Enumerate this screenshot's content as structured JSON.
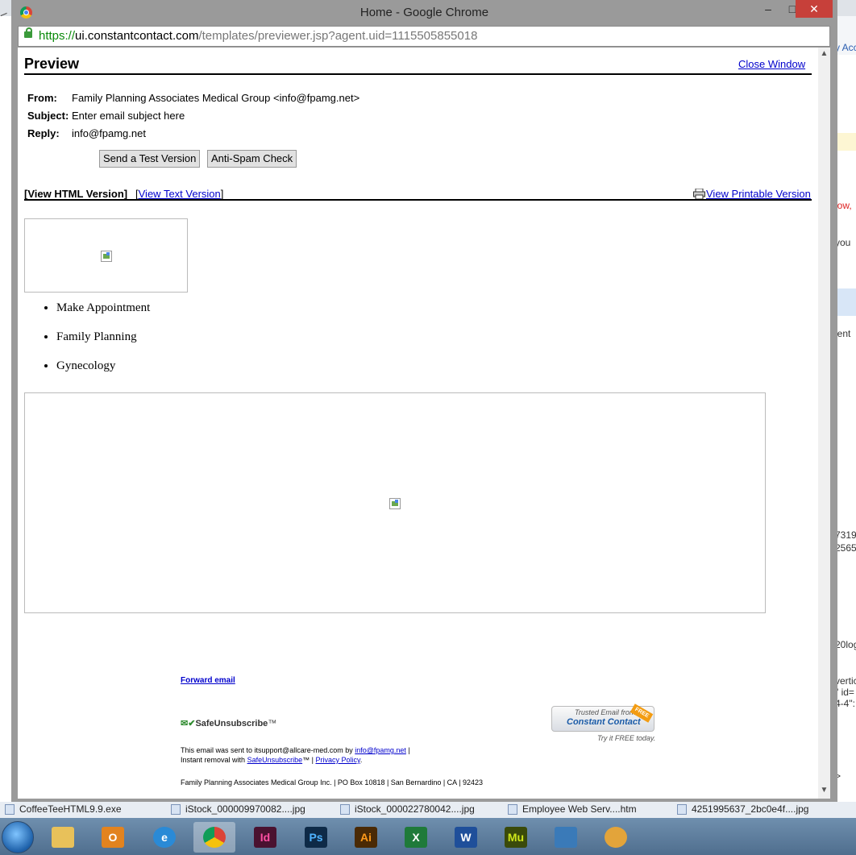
{
  "window": {
    "title": "Home - Google Chrome",
    "minimize": "–",
    "maximize": "□",
    "close": "✕"
  },
  "address": {
    "scheme": "https://",
    "host": "ui.constantcontact.com",
    "path": "/templates/previewer.jsp?agent.uid=1115505855018"
  },
  "preview": {
    "title": "Preview",
    "close_window": "Close Window",
    "from_label": "From:",
    "from_value": "Family Planning Associates Medical Group <info@fpamg.net>",
    "subject_label": "Subject:",
    "subject_value": "Enter email subject here",
    "reply_label": "Reply:",
    "reply_value": "info@fpamg.net",
    "send_test": "Send a Test Version",
    "anti_spam": "Anti-Spam Check",
    "view_html": "[View HTML Version]",
    "view_text_open": "[",
    "view_text": "View Text Version",
    "view_text_close": "]",
    "view_printable": "View Printable Version"
  },
  "email": {
    "menu_items": [
      "Make Appointment",
      "Family Planning",
      "Gynecology"
    ],
    "forward_email": "Forward email",
    "safeunsubscribe_logo": "SafeUnsubscribe",
    "safeunsubscribe_tm": "™",
    "trusted_line1": "Trusted Email from",
    "trusted_line2": "Constant Contact",
    "trusted_free": "FREE",
    "try_free": "Try it FREE today.",
    "sent_to_prefix": "This email was sent to itsupport@allcare-med.com by",
    "sent_by_link": "info@fpamg.net",
    "sep": "|",
    "instant_removal": "Instant removal with",
    "safeunsubscribe_link": "SafeUnsubscribe",
    "tm": "™",
    "privacy_policy": "Privacy Policy",
    "period": ".",
    "address_line": "Family Planning Associates Medical Group Inc. | PO Box 10818 | San Bernardino | CA | 92423"
  },
  "background": {
    "back_arrow": "<",
    "frag_acc": "y Acc",
    "frag_low": "low,",
    "frag_you": "you",
    "frag_ient": "ient",
    "frag_731": "7319",
    "frag_256": "2565",
    "frag_20log": "20log",
    "frag_vertic": "vertic",
    "frag_id": "\" id=",
    "frag_44": "4-4\":",
    "frag_gt": ">"
  },
  "taskrow": {
    "files": [
      "CoffeeTeeHTML9.9.exe",
      "iStock_000009970082....jpg",
      "iStock_000022780042....jpg",
      "Employee Web Serv....htm",
      "4251995637_2bc0e4f....jpg"
    ]
  },
  "taskbar": {
    "apps": [
      {
        "name": "file-explorer",
        "label": "",
        "color": "#e8c15a"
      },
      {
        "name": "outlook",
        "label": "O",
        "color": "#e2831f"
      },
      {
        "name": "internet-explorer",
        "label": "e",
        "color": "#2a8ad6"
      },
      {
        "name": "chrome",
        "label": "",
        "color": "#db4437"
      },
      {
        "name": "indesign",
        "label": "Id",
        "color": "#4a1230"
      },
      {
        "name": "photoshop",
        "label": "Ps",
        "color": "#0e2a47"
      },
      {
        "name": "illustrator",
        "label": "Ai",
        "color": "#4a2a05"
      },
      {
        "name": "excel",
        "label": "X",
        "color": "#1f7a3a"
      },
      {
        "name": "word",
        "label": "W",
        "color": "#1f4f9a"
      },
      {
        "name": "muse",
        "label": "Mu",
        "color": "#3a4a0a"
      },
      {
        "name": "photo-viewer",
        "label": "",
        "color": "#3a7ab8"
      },
      {
        "name": "user-app",
        "label": "",
        "color": "#e3a43a"
      }
    ]
  }
}
